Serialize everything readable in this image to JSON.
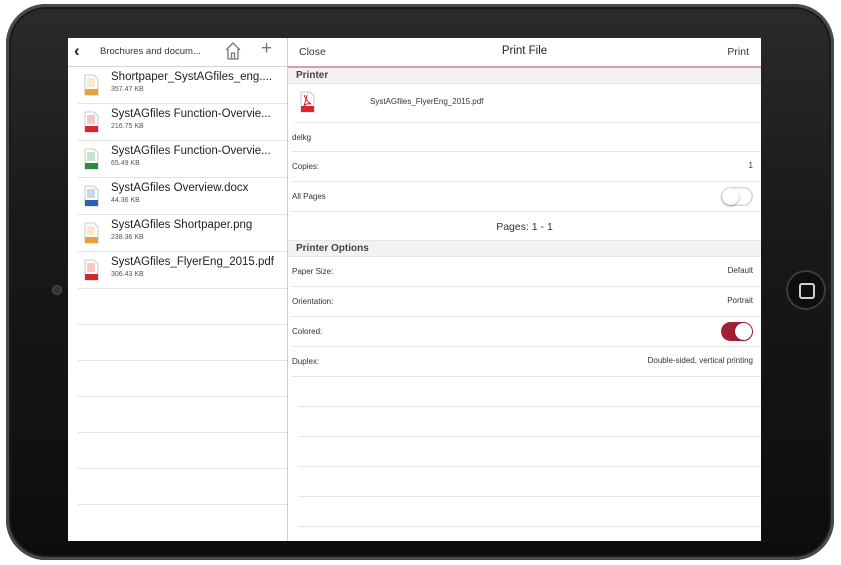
{
  "left": {
    "folder_title": "Brochures and docum...",
    "files": [
      {
        "name": "Shortpaper_SystAGfiles_eng....",
        "size": "357.47 KB",
        "icon": "txt-file-icon",
        "tag": "TXT",
        "color": "#e9a23b"
      },
      {
        "name": "SystAGfiles Function-Overvie...",
        "size": "216.75 KB",
        "icon": "pdf-file-icon",
        "tag": "PDF",
        "color": "#d8262d"
      },
      {
        "name": "SystAGfiles Function-Overvie...",
        "size": "65.49 KB",
        "icon": "xls-file-icon",
        "tag": "XLS",
        "color": "#2e8b3c"
      },
      {
        "name": "SystAGfiles Overview.docx",
        "size": "44.36 KB",
        "icon": "doc-file-icon",
        "tag": "DOC",
        "color": "#2c62b3"
      },
      {
        "name": "SystAGfiles Shortpaper.png",
        "size": "238.36 KB",
        "icon": "png-file-icon",
        "tag": "PNG",
        "color": "#e9a23b"
      },
      {
        "name": "SystAGfiles_FlyerEng_2015.pdf",
        "size": "306.43 KB",
        "icon": "pdf-file-icon",
        "tag": "PDF",
        "color": "#d8262d"
      }
    ]
  },
  "right": {
    "close_label": "Close",
    "title": "Print File",
    "print_label": "Print",
    "printer_section": "Printer",
    "pdf_name": "SystAGfiles_FlyerEng_2015.pdf",
    "printer_name": "delkg",
    "copies_label": "Copies:",
    "copies_value": "1",
    "all_pages_label": "All Pages",
    "all_pages_on": false,
    "pages_text": "Pages: 1 - 1",
    "options_section": "Printer Options",
    "paper_size_label": "Paper Size:",
    "paper_size_value": "Default",
    "orientation_label": "Orientation:",
    "orientation_value": "Portrait",
    "colored_label": "Colored:",
    "colored_on": true,
    "duplex_label": "Duplex:",
    "duplex_value": "Double-sided, vertical printing"
  },
  "colors": {
    "accent": "#a31f36",
    "header_line": "#d9a0a0"
  }
}
